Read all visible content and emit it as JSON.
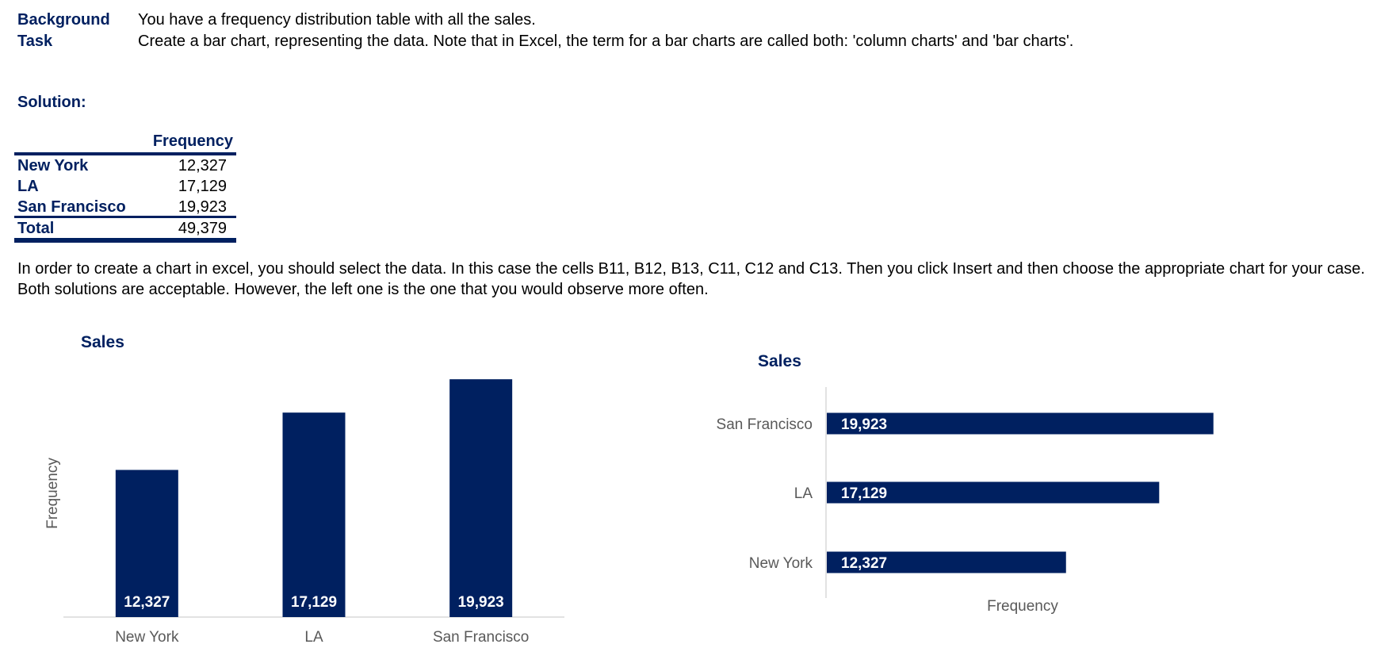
{
  "header": {
    "background_label": "Background",
    "background_text": "You have a frequency distribution table with all the sales.",
    "task_label": "Task",
    "task_text": "Create a bar chart, representing the data. Note that in Excel, the term for a bar charts are called both:  'column charts' and 'bar charts'."
  },
  "solution_label": "Solution:",
  "table": {
    "column_header": "Frequency",
    "rows": [
      {
        "label": "New York",
        "value": "12,327"
      },
      {
        "label": "LA",
        "value": "17,129"
      },
      {
        "label": "San Francisco",
        "value": "19,923"
      }
    ],
    "total": {
      "label": "Total",
      "value": "49,379"
    }
  },
  "instructions": {
    "line1": "In order to create a chart in excel, you should select the data. In this case the cells B11, B12, B13, C11, C12 and C13. Then you click Insert and then choose the appropriate chart for your case.",
    "line2": "Both solutions are acceptable. However, the left one is the one that you would observe more often."
  },
  "colors": {
    "navy": "#002060",
    "axis_text": "#595959",
    "axis_line": "#d9d9d9"
  },
  "chart_data": [
    {
      "type": "bar",
      "orientation": "vertical",
      "title": "Sales",
      "xlabel": "",
      "ylabel": "Frequency",
      "categories": [
        "New York",
        "LA",
        "San Francisco"
      ],
      "values": [
        12327,
        17129,
        19923
      ],
      "data_labels": [
        "12,327",
        "17,129",
        "19,923"
      ],
      "ylim": [
        0,
        20000
      ],
      "grid": false,
      "legend": "none"
    },
    {
      "type": "bar",
      "orientation": "horizontal",
      "title": "Sales",
      "xlabel": "Frequency",
      "ylabel": "",
      "categories": [
        "San Francisco",
        "LA",
        "New York"
      ],
      "values": [
        19923,
        17129,
        12327
      ],
      "data_labels": [
        "19,923",
        "17,129",
        "12,327"
      ],
      "xlim": [
        0,
        25000
      ],
      "grid": false,
      "legend": "none"
    }
  ]
}
